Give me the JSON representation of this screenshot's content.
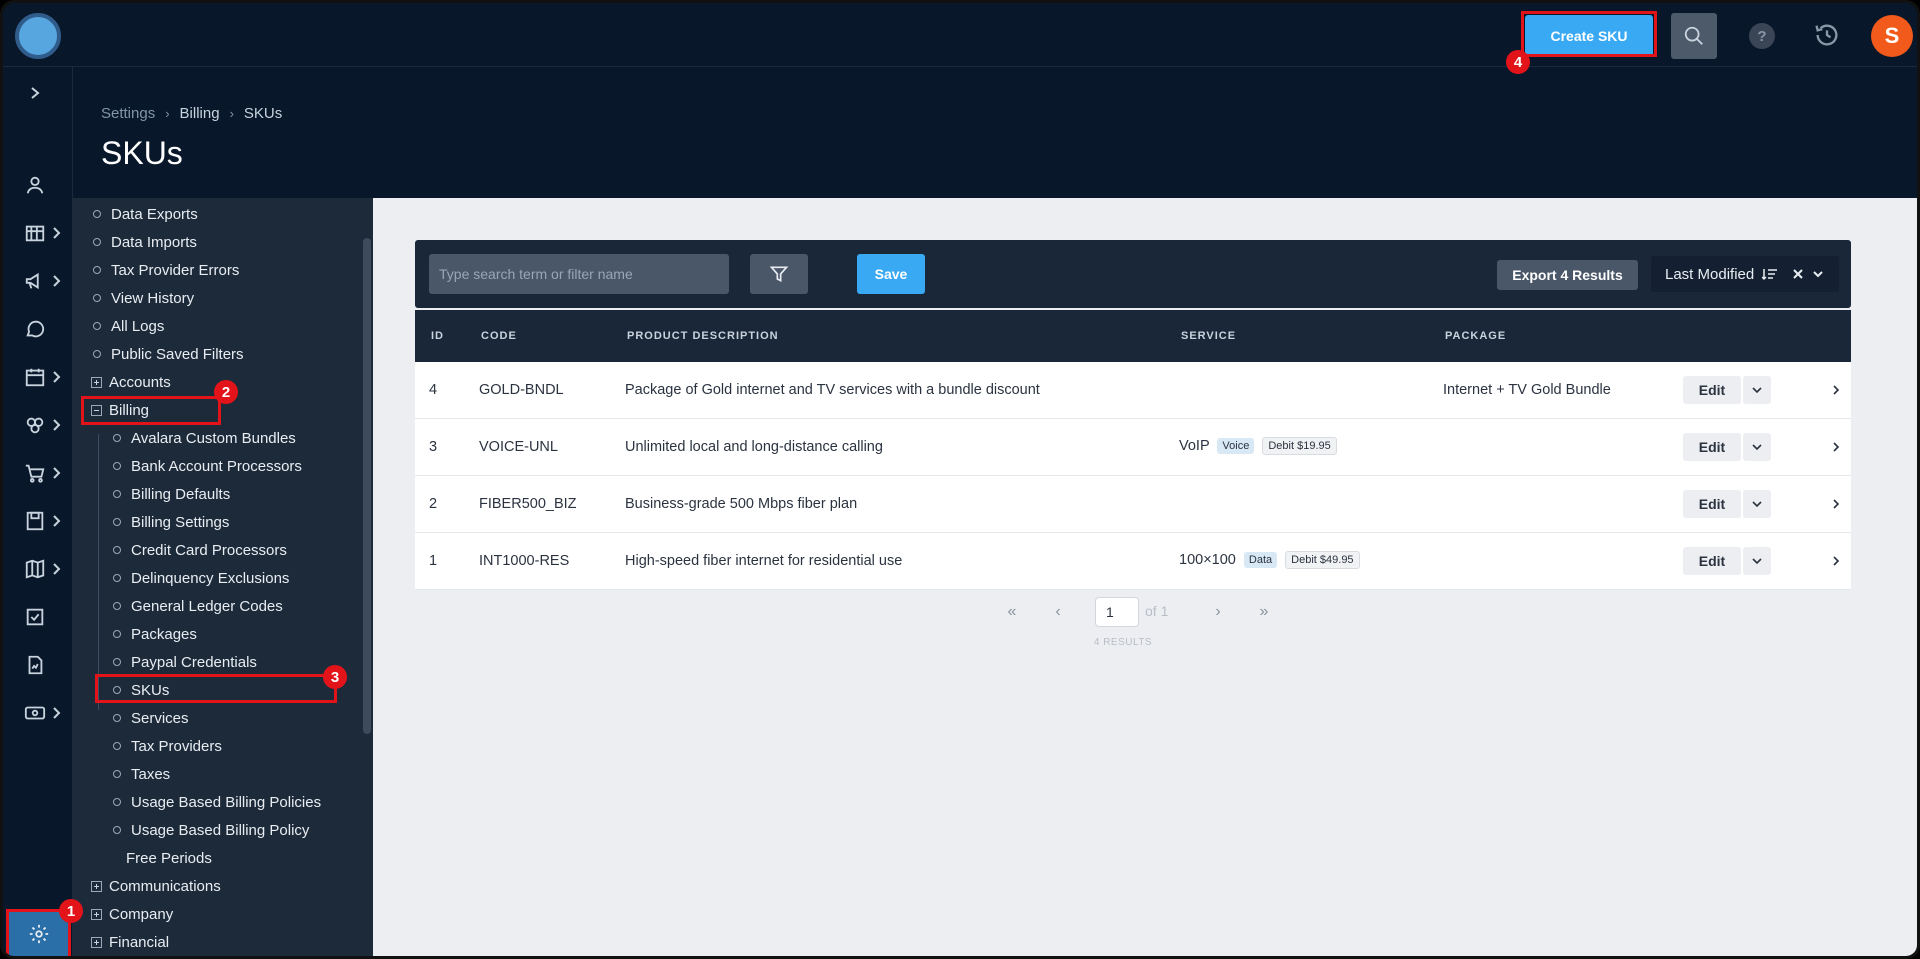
{
  "topbar": {
    "create_label": "Create SKU",
    "avatar_initial": "S",
    "help_glyph": "?"
  },
  "breadcrumb": [
    "Settings",
    "Billing",
    "SKUs"
  ],
  "page_title": "SKUs",
  "tree": {
    "top_items": [
      "Data Exports",
      "Data Imports",
      "Tax Provider Errors",
      "View History",
      "All Logs",
      "Public Saved Filters"
    ],
    "accounts": "Accounts",
    "billing": "Billing",
    "billing_children": [
      "Avalara Custom Bundles",
      "Bank Account Processors",
      "Billing Defaults",
      "Billing Settings",
      "Credit Card Processors",
      "Delinquency Exclusions",
      "General Ledger Codes",
      "Packages",
      "Paypal Credentials",
      "SKUs",
      "Services",
      "Tax Providers",
      "Taxes",
      "Usage Based Billing Policies",
      "Usage Based Billing Policy"
    ],
    "free_periods": "Free Periods",
    "bottom_groups": [
      "Communications",
      "Company",
      "Financial"
    ]
  },
  "toolbar": {
    "search_placeholder": "Type search term or filter name",
    "save_label": "Save",
    "export_label": "Export 4 Results",
    "sort_label": "Last Modified"
  },
  "table": {
    "headers": [
      "ID",
      "CODE",
      "PRODUCT DESCRIPTION",
      "SERVICE",
      "PACKAGE"
    ],
    "rows": [
      {
        "id": "4",
        "code": "GOLD-BNDL",
        "description": "Package of Gold internet and TV services with a bundle discount",
        "service": "",
        "service_tag": "",
        "service_price": "",
        "package": "Internet + TV Gold Bundle"
      },
      {
        "id": "3",
        "code": "VOICE-UNL",
        "description": "Unlimited local and long-distance calling",
        "service": "VoIP",
        "service_tag": "Voice",
        "service_price": "Debit $19.95",
        "package": ""
      },
      {
        "id": "2",
        "code": "FIBER500_BIZ",
        "description": "Business-grade 500 Mbps fiber plan",
        "service": "",
        "service_tag": "",
        "service_price": "",
        "package": ""
      },
      {
        "id": "1",
        "code": "INT1000-RES",
        "description": "High-speed fiber internet for residential use",
        "service": "100×100",
        "service_tag": "Data",
        "service_price": "Debit $49.95",
        "package": ""
      }
    ],
    "edit_label": "Edit"
  },
  "pager": {
    "page": "1",
    "of_label": "of 1",
    "results_label": "4 RESULTS",
    "first": "«",
    "prev": "‹",
    "next": "›",
    "last": "»"
  },
  "annotations": [
    "1",
    "2",
    "3",
    "4"
  ],
  "colors": {
    "accent": "#3aa9f4",
    "highlight": "#e3131a",
    "nav_bg": "#08172a",
    "avatar": "#f25a1c"
  }
}
